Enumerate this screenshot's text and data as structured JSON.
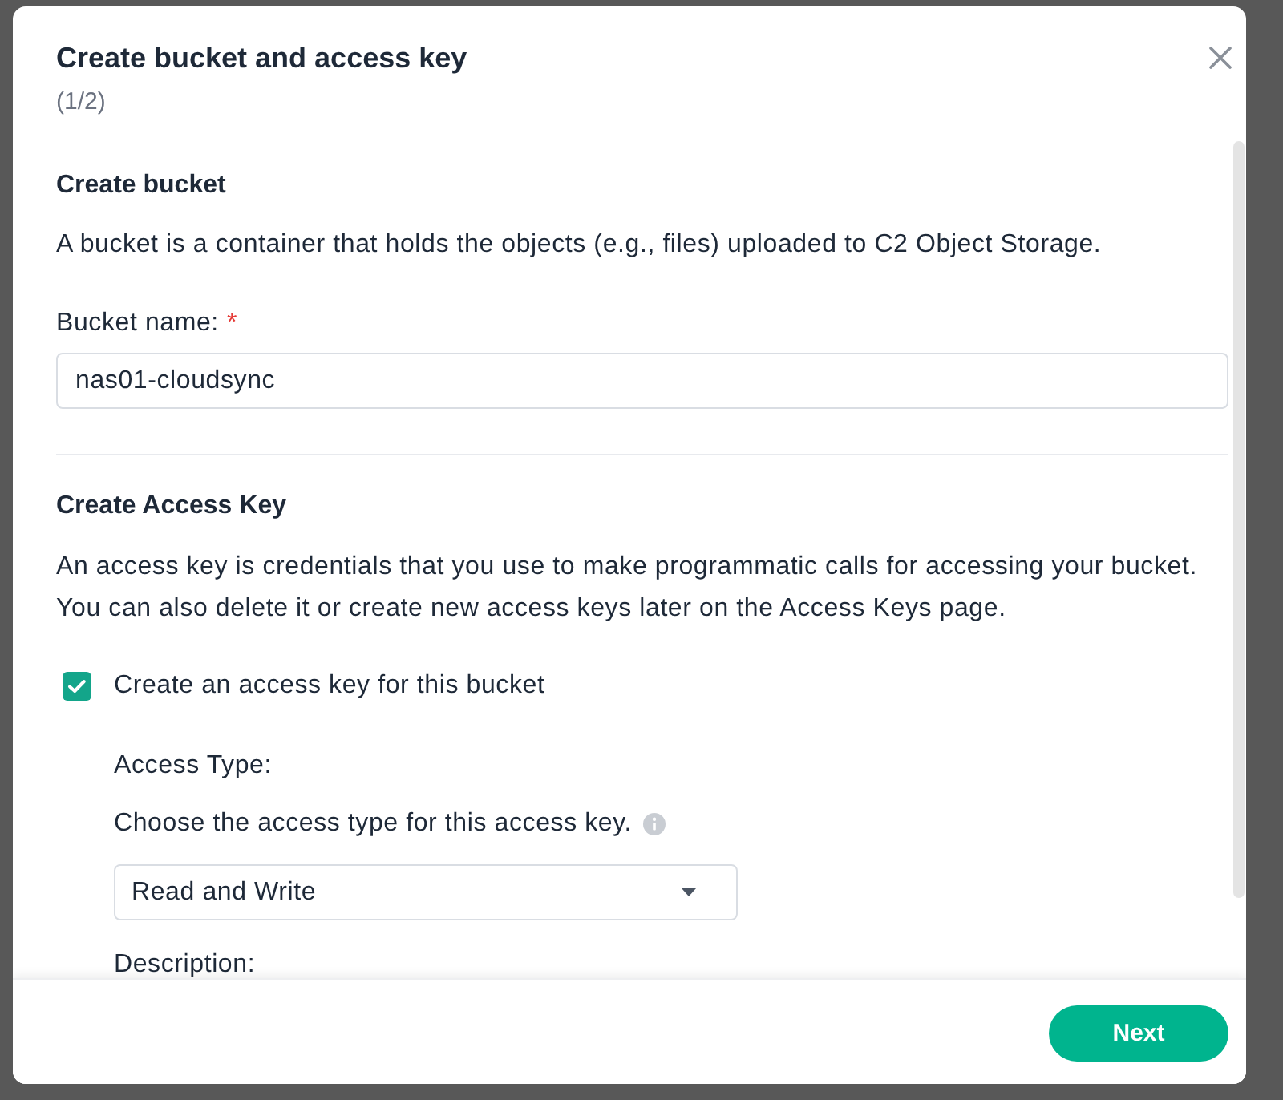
{
  "dialog": {
    "title": "Create bucket and access key",
    "step": "(1/2)"
  },
  "bucket_section": {
    "heading": "Create bucket",
    "description": "A bucket is a container that holds the objects (e.g., files) uploaded to C2 Object Storage.",
    "field": {
      "label": "Bucket name:",
      "required_mark": "*",
      "value": "nas01-cloudsync"
    }
  },
  "access_key_section": {
    "heading": "Create Access Key",
    "description": "An access key is credentials that you use to make programmatic calls for accessing your bucket. You can also delete it or create new access keys later on the Access Keys page.",
    "checkbox": {
      "label": "Create an access key for this bucket",
      "checked": true
    },
    "access_type": {
      "label": "Access Type:",
      "hint": "Choose the access type for this access key.",
      "value": "Read and Write"
    },
    "description_field": {
      "label": "Description:"
    }
  },
  "footer": {
    "buttons": [
      {
        "label": "Next",
        "kind": "primary"
      }
    ]
  }
}
